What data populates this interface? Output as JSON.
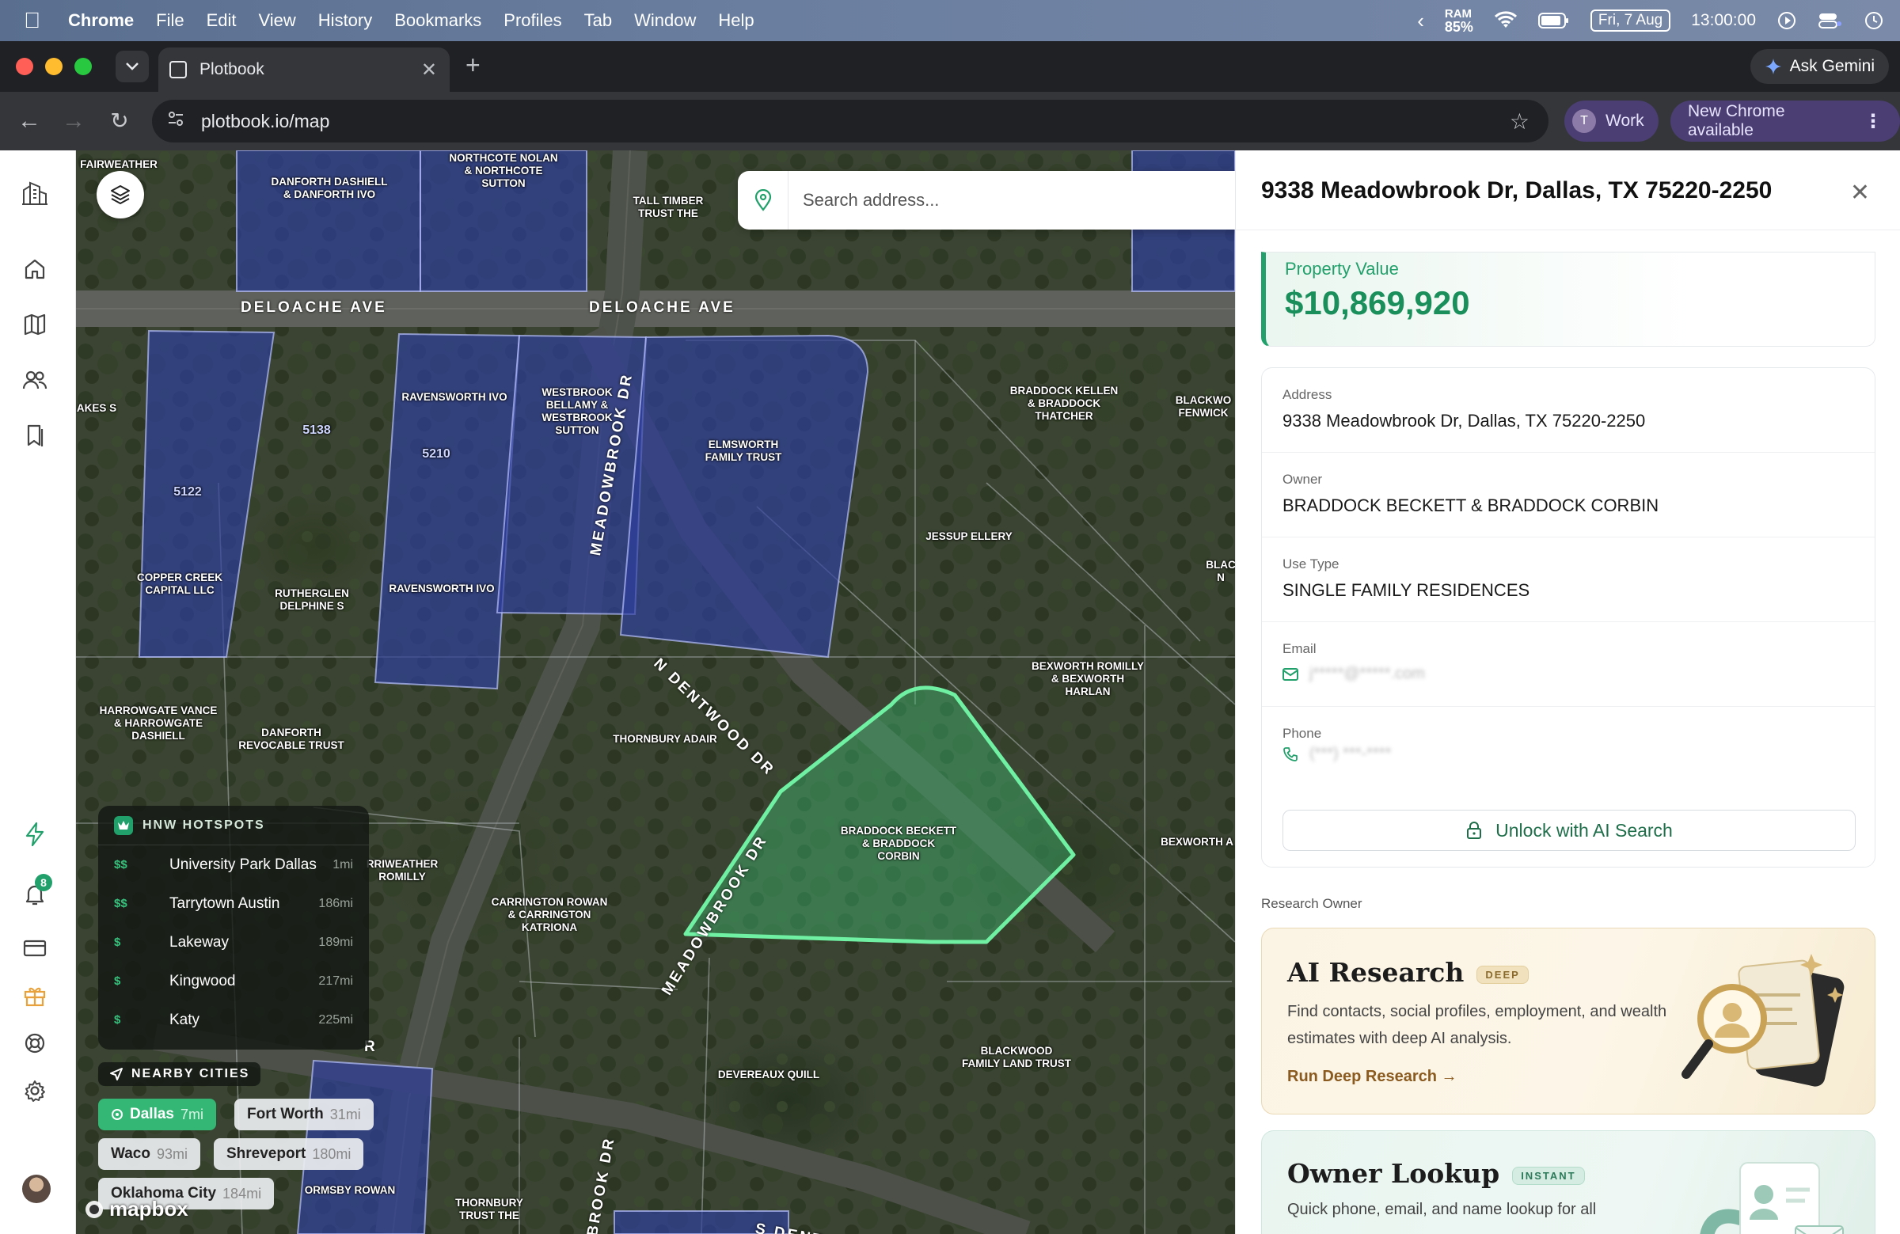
{
  "menubar": {
    "app_name": "Chrome",
    "menus": [
      "File",
      "Edit",
      "View",
      "History",
      "Bookmarks",
      "Profiles",
      "Tab",
      "Window",
      "Help"
    ],
    "ram_label": "RAM",
    "ram_value": "85%",
    "date": "Fri, 7 Aug",
    "time": "13:00:00"
  },
  "browser": {
    "tab_title": "Plotbook",
    "url": "plotbook.io/map",
    "gemini_label": "Ask Gemini",
    "profile_initial": "T",
    "profile_name": "Work",
    "update_label": "New Chrome available"
  },
  "sidebar": {
    "notification_count": "8",
    "icons": [
      "buildings-icon",
      "home-icon",
      "map-icon",
      "people-icon",
      "bookmark-icon",
      "lightning-icon",
      "bell-icon",
      "card-icon",
      "gift-icon",
      "lifebuoy-icon",
      "gear-icon"
    ]
  },
  "map": {
    "search_placeholder": "Search address...",
    "roads": {
      "deloache_1": "DELOACHE AVE",
      "deloache_2": "DELOACHE AVE",
      "meadowbrook_1": "MEADOWBROOK DR",
      "meadowbrook_2": "MEADOWBROOK DR",
      "meadowbrook_3": "BROOK DR",
      "dentwood": "N DENTWOOD DR",
      "s_dent": "S DENT",
      "r_fragment": "R"
    },
    "parcel_labels": [
      "FAIRWEATHER",
      "DANFORTH DASHIELL\n& DANFORTH IVO",
      "NORTHCOTE NOLAN\n& NORTHCOTE\nSUTTON",
      "TALL TIMBER\nTRUST THE",
      "RAVENSWORTH IVO",
      "WESTBROOK\nBELLAMY &\nWESTBROOK\nSUTTON",
      "ELMSWORTH\nFAMILY TRUST",
      "BRADDOCK KELLEN\n& BRADDOCK\nTHATCHER",
      "BLACKWO\nFENWICK",
      "AKES S",
      "COPPER CREEK\nCAPITAL LLC",
      "RUTHERGLEN\nDELPHINE S",
      "RAVENSWORTH IVO",
      "JESSUP ELLERY",
      "BLAC\nN",
      "HARROWGATE VANCE\n& HARROWGATE\nDASHIELL",
      "DANFORTH\nREVOCABLE TRUST",
      "THORNBURY ADAIR",
      "BEXWORTH ROMILLY\n& BEXWORTH\nHARLAN",
      "BRADDOCK BECKETT\n& BRADDOCK\nCORBIN",
      "RRIWEATHER\nROMILLY",
      "CARRINGTON ROWAN\n& CARRINGTON\nKATRIONA",
      "BEXWORTH A",
      "DEVEREAUX QUILL",
      "BLACKWOOD\nFAMILY LAND TRUST",
      "ORMSBY ROWAN",
      "THORNBURY\nTRUST THE",
      "5138",
      "5210",
      "5122"
    ],
    "hnw": {
      "title": "HNW HOTSPOTS",
      "rows": [
        {
          "tier": "$$",
          "name": "University Park Dallas",
          "dist": "1mi"
        },
        {
          "tier": "$$",
          "name": "Tarrytown Austin",
          "dist": "186mi"
        },
        {
          "tier": "$",
          "name": "Lakeway",
          "dist": "189mi"
        },
        {
          "tier": "$",
          "name": "Kingwood",
          "dist": "217mi"
        },
        {
          "tier": "$",
          "name": "Katy",
          "dist": "225mi"
        }
      ]
    },
    "nearby": {
      "title": "NEARBY CITIES",
      "cities": [
        {
          "name": "Dallas",
          "dist": "7mi"
        },
        {
          "name": "Fort Worth",
          "dist": "31mi"
        },
        {
          "name": "Waco",
          "dist": "93mi"
        },
        {
          "name": "Shreveport",
          "dist": "180mi"
        },
        {
          "name": "Oklahoma City",
          "dist": "184mi"
        }
      ]
    },
    "attribution": "mapbox"
  },
  "panel": {
    "title": "9338 Meadowbrook Dr, Dallas, TX 75220-2250",
    "value_label": "Property Value",
    "value_amount": "$10,869,920",
    "fields": {
      "address_label": "Address",
      "address_value": "9338 Meadowbrook Dr, Dallas, TX 75220-2250",
      "owner_label": "Owner",
      "owner_value": "BRADDOCK BECKETT & BRADDOCK CORBIN",
      "use_label": "Use Type",
      "use_value": "SINGLE FAMILY RESIDENCES",
      "email_label": "Email",
      "email_value": "j*****@*****.com",
      "phone_label": "Phone",
      "phone_value": "(***) ***-****"
    },
    "unlock_label": "Unlock with AI Search",
    "research_label": "Research Owner",
    "ai_research": {
      "title": "AI Research",
      "tag": "DEEP",
      "description": "Find contacts, social profiles, employment, and wealth estimates with deep AI analysis.",
      "link": "Run Deep Research →"
    },
    "owner_lookup": {
      "title": "Owner Lookup",
      "tag": "INSTANT",
      "description": "Quick phone, email, and name lookup for all"
    }
  }
}
